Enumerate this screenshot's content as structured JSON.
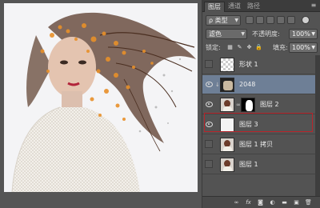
{
  "panel": {
    "tabs": [
      {
        "label": "图层",
        "active": true
      },
      {
        "label": "通道",
        "active": false
      },
      {
        "label": "路径",
        "active": false
      }
    ],
    "filter_kind": "ρ 类型",
    "blend_mode": "滤色",
    "opacity_label": "不透明度:",
    "opacity_value": "100%",
    "lock_label": "锁定:",
    "fill_label": "填充:",
    "fill_value": "100%"
  },
  "layers": [
    {
      "name": "形状 1",
      "visible": false,
      "selected": false
    },
    {
      "name": "2048",
      "visible": true,
      "selected": true
    },
    {
      "name": "图层 2",
      "visible": true,
      "selected": false
    },
    {
      "name": "图层 3",
      "visible": true,
      "selected": false,
      "highlighted": true
    },
    {
      "name": "图层 1 拷贝",
      "visible": false,
      "selected": false
    },
    {
      "name": "图层 1",
      "visible": false,
      "selected": false
    }
  ],
  "bottom_icons": [
    "link-icon",
    "fx-icon",
    "mask-icon",
    "adjustment-icon",
    "folder-icon",
    "new-layer-icon",
    "trash-icon"
  ],
  "colors": {
    "selection": "#6e7f96",
    "highlight_border": "#b8242a",
    "panel_bg": "#535353",
    "accent_orange": "#e8902a"
  }
}
